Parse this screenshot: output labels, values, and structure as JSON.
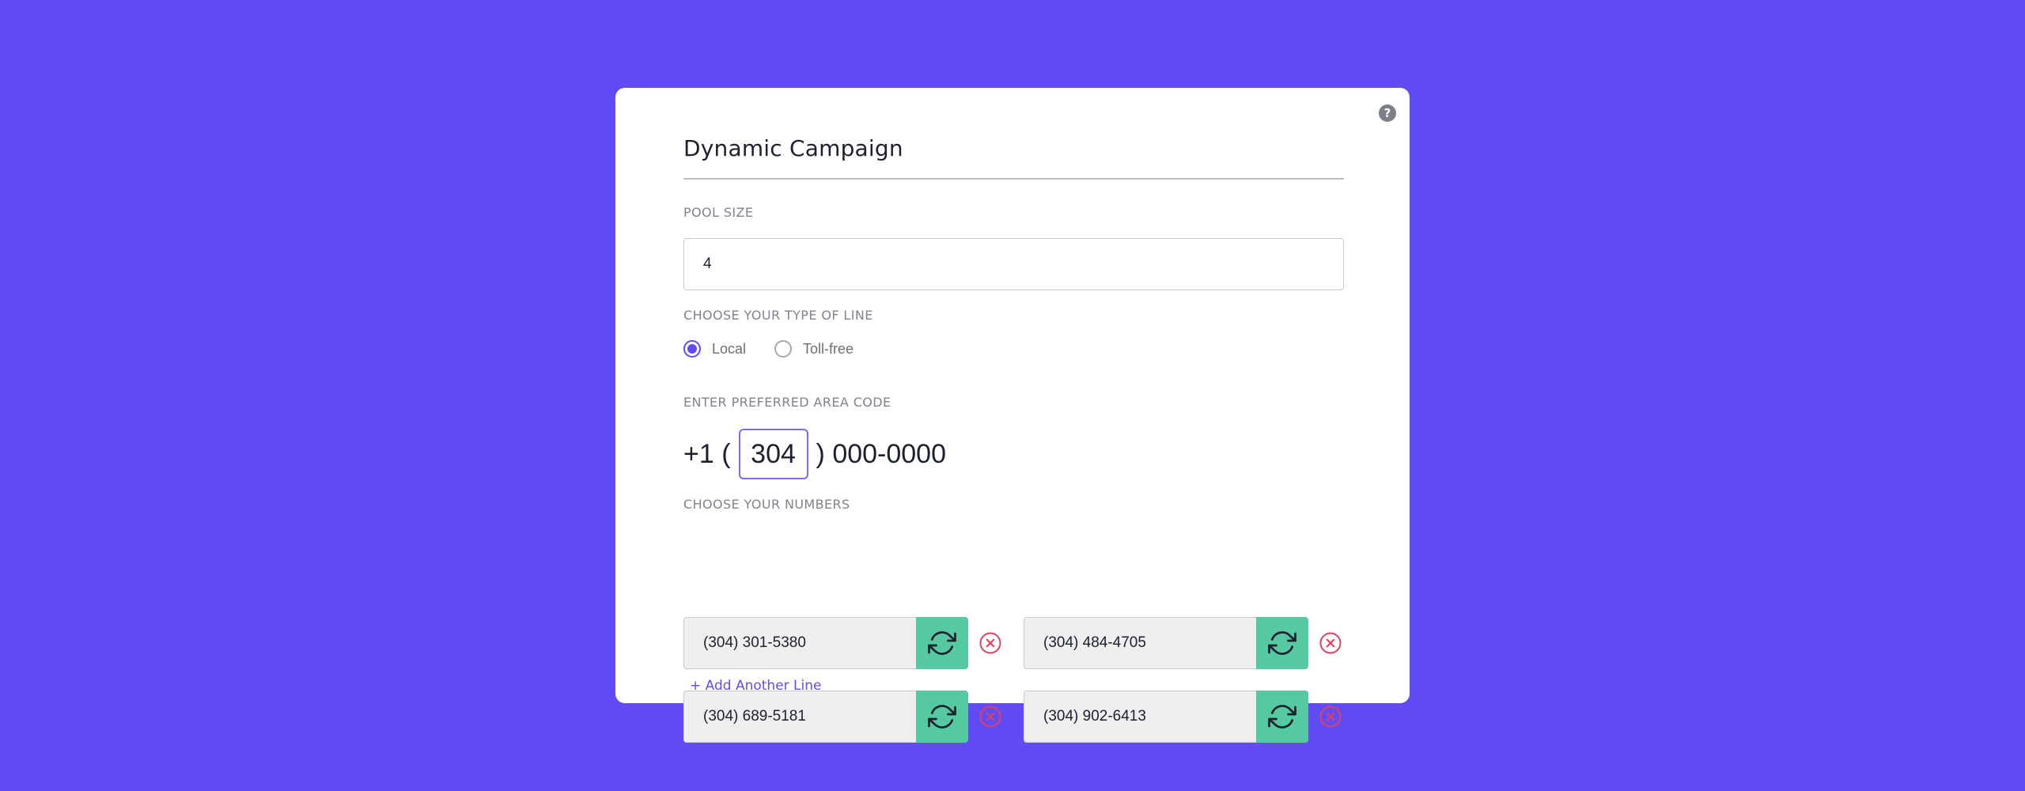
{
  "page_title": "Dynamic Campaign",
  "help_icon": "?",
  "pool_size": {
    "label": "POOL SIZE",
    "value": "4"
  },
  "line_type": {
    "label": "CHOOSE YOUR TYPE OF LINE",
    "options": [
      {
        "label": "Local",
        "selected": true
      },
      {
        "label": "Toll-free",
        "selected": false
      }
    ]
  },
  "area_code": {
    "label": "ENTER PREFERRED AREA CODE",
    "prefix": "+1 (",
    "value": "304",
    "suffix": ") 000-0000"
  },
  "numbers": {
    "label": "CHOOSE YOUR NUMBERS",
    "items": [
      {
        "number": "(304) 301-5380"
      },
      {
        "number": "(304) 484-4705"
      },
      {
        "number": "(304) 689-5181"
      },
      {
        "number": "(304) 902-6413"
      }
    ],
    "add_label": "+ Add Another Line"
  },
  "icons": {
    "help": "question-circle-icon",
    "refresh": "refresh-icon",
    "remove": "close-circle-icon"
  },
  "colors": {
    "background": "#614bf5",
    "accent": "#614bf5",
    "refresh_button": "#55c9a0",
    "remove_icon": "#e0405e"
  }
}
